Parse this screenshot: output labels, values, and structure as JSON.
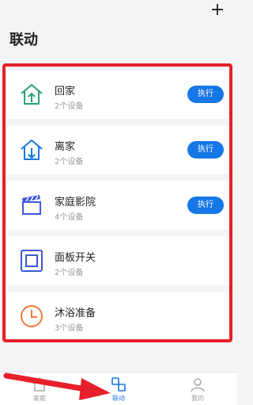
{
  "header": {
    "title": "联动",
    "add_label": "+"
  },
  "scenes": [
    {
      "name": "回家",
      "count": "2个设备",
      "action": "执行",
      "icon": "home-in-icon"
    },
    {
      "name": "离家",
      "count": "2个设备",
      "action": "执行",
      "icon": "home-out-icon"
    },
    {
      "name": "家庭影院",
      "count": "4个设备",
      "action": "执行",
      "icon": "clapperboard-icon"
    },
    {
      "name": "面板开关",
      "count": "2个设备",
      "action": "",
      "icon": "panel-switch-icon"
    },
    {
      "name": "沐浴准备",
      "count": "3个设备",
      "action": "",
      "icon": "clock-icon"
    }
  ],
  "tabs": [
    {
      "label": "家庭",
      "icon": "house-icon"
    },
    {
      "label": "联动",
      "icon": "linkage-icon"
    },
    {
      "label": "我的",
      "icon": "user-icon"
    }
  ],
  "colors": {
    "accent": "#1677e6",
    "annotation": "#e6202a",
    "home_icon": "#2aa36b",
    "clock_icon": "#f07a3a"
  }
}
